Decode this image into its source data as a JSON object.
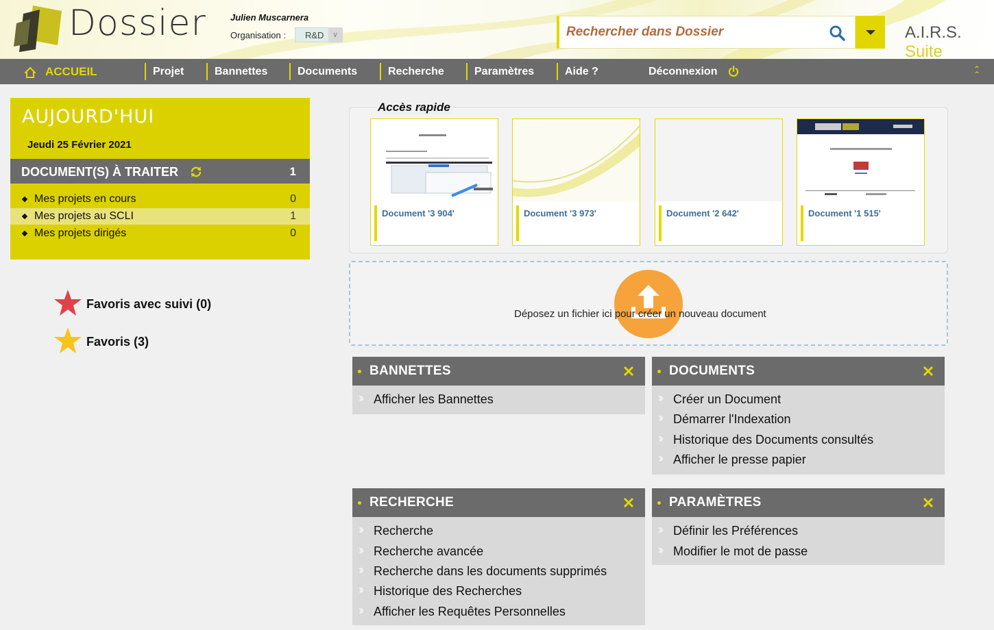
{
  "header": {
    "app_name": "Dossier",
    "user_name": "Julien Muscarnera",
    "org_label": "Organisation :",
    "org_value": "R&D",
    "search_placeholder": "Rechercher dans Dossier",
    "brand_main": "A.I.R.S.",
    "brand_suite": "Suite"
  },
  "nav": {
    "home": "ACCUEIL",
    "items": [
      "Projet",
      "Bannettes",
      "Documents",
      "Recherche",
      "Paramètres",
      "Aide ?"
    ],
    "logout": "Déconnexion"
  },
  "today": {
    "title": "AUJOURD'HUI",
    "date": "Jeudi 25 Février 2021",
    "todo_label": "DOCUMENT(S) À TRAITER",
    "todo_count": "1",
    "rows": [
      {
        "label": "Mes projets en cours",
        "count": "0"
      },
      {
        "label": "Mes projets au SCLI",
        "count": "1"
      },
      {
        "label": "Mes projets dirigés",
        "count": "0"
      }
    ]
  },
  "favorites": {
    "tracked": "Favoris avec suivi (0)",
    "plain": "Favoris (3)"
  },
  "quick_access": {
    "title": "Accès rapide",
    "cards": [
      {
        "label": "Document '3 904'"
      },
      {
        "label": "Document '3 973'"
      },
      {
        "label": "Document '2 642'"
      },
      {
        "label": "Document '1 515'"
      }
    ]
  },
  "dropzone": {
    "text": "Déposez un fichier ici pour créer un nouveau document"
  },
  "panels": {
    "bannettes": {
      "title": "BANNETTES",
      "links": [
        "Afficher les Bannettes"
      ]
    },
    "documents": {
      "title": "DOCUMENTS",
      "links": [
        "Créer un Document",
        "Démarrer l'Indexation",
        "Historique des Documents consultés",
        "Afficher le presse papier"
      ]
    },
    "recherche": {
      "title": "RECHERCHE",
      "links": [
        "Recherche",
        "Recherche avancée",
        "Recherche dans les documents supprimés",
        "Historique des Recherches",
        "Afficher les Requêtes Personnelles"
      ]
    },
    "parametres": {
      "title": "PARAMÈTRES",
      "links": [
        "Définir les Préférences",
        "Modifier le mot de passe"
      ]
    }
  },
  "colors": {
    "accent_yellow": "#e2d800",
    "nav_gray": "#6b6b6b",
    "upload_orange": "#f5a33a",
    "link_blue": "#3a6f9a",
    "favorite_red": "#e0414a",
    "favorite_yellow": "#f7c31c"
  }
}
